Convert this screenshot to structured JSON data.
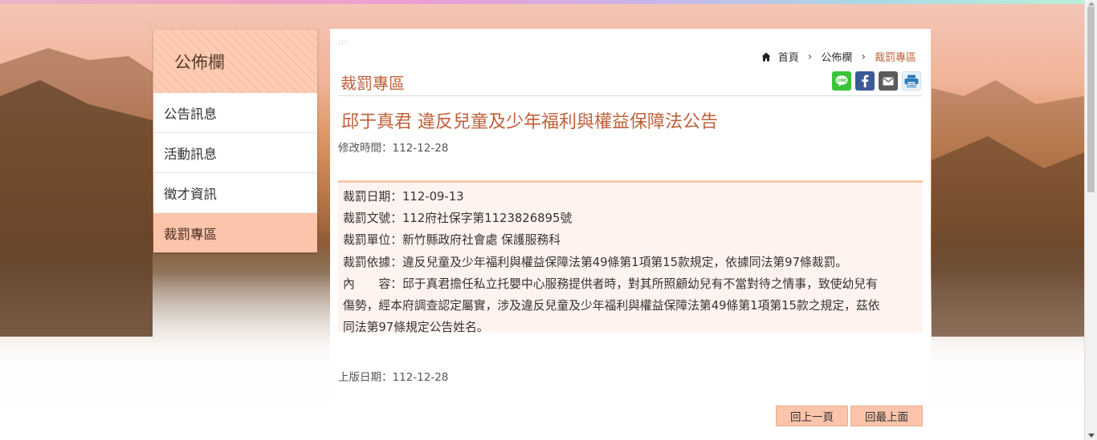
{
  "sidebar": {
    "title": "公佈欄",
    "items": [
      {
        "label": "公告訊息",
        "active": false
      },
      {
        "label": "活動訊息",
        "active": false
      },
      {
        "label": "徵才資訊",
        "active": false
      },
      {
        "label": "裁罰專區",
        "active": true
      }
    ]
  },
  "breadcrumb": {
    "home": "首頁",
    "level1": "公佈欄",
    "current": "裁罰專區"
  },
  "section": {
    "title": "裁罰專區"
  },
  "share": {
    "icons": [
      "line-icon",
      "facebook-icon",
      "mail-icon",
      "print-icon"
    ]
  },
  "article": {
    "title": "邱于真君 違反兒童及少年福利與權益保障法公告",
    "modified": "修改時間：112-12-28",
    "lines": [
      "裁罰日期：112-09-13",
      "裁罰文號：112府社保字第1123826895號",
      "裁罰單位：新竹縣政府社會處 保護服務科",
      "裁罰依據：違反兒童及少年福利與權益保障法第49條第1項第15款規定，依據同法第97條裁罰。",
      "內　　容：邱于真君擔任私立托嬰中心服務提供者時，對其所照顧幼兒有不當對待之情事，致使幼兒有",
      "傷勢，經本府調查認定屬實，涉及違反兒童及少年福利與權益保障法第49條第1項第15款之規定，茲依",
      "同法第97條規定公告姓名。"
    ],
    "published": "上版日期：112-12-28"
  },
  "buttons": {
    "back": "回上一頁",
    "top": "回最上面"
  },
  "colors": {
    "accent": "#c0603a",
    "tab_active": "#fbc4ab"
  }
}
